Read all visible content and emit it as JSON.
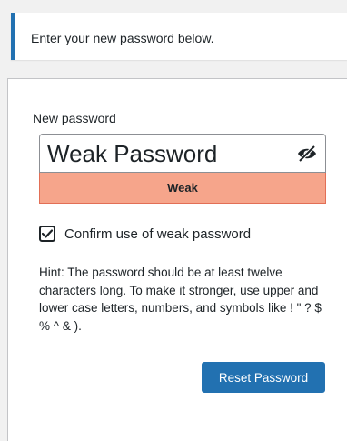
{
  "message": {
    "text": "Enter your new password below."
  },
  "form": {
    "password_label": "New password",
    "password_value": "Weak Password",
    "visibility_icon": "eye-slash-icon",
    "strength_label": "Weak",
    "confirm_checked": true,
    "confirm_label": "Confirm use of weak password",
    "hint": "Hint: The password should be at least twelve characters long. To make it stronger, use upper and lower case letters, numbers, and symbols like ! \" ? $ % ^ & ).",
    "submit_label": "Reset Password"
  },
  "colors": {
    "accent": "#2271b1",
    "weak_background": "#f6a58b",
    "weak_border": "#e26f56"
  }
}
